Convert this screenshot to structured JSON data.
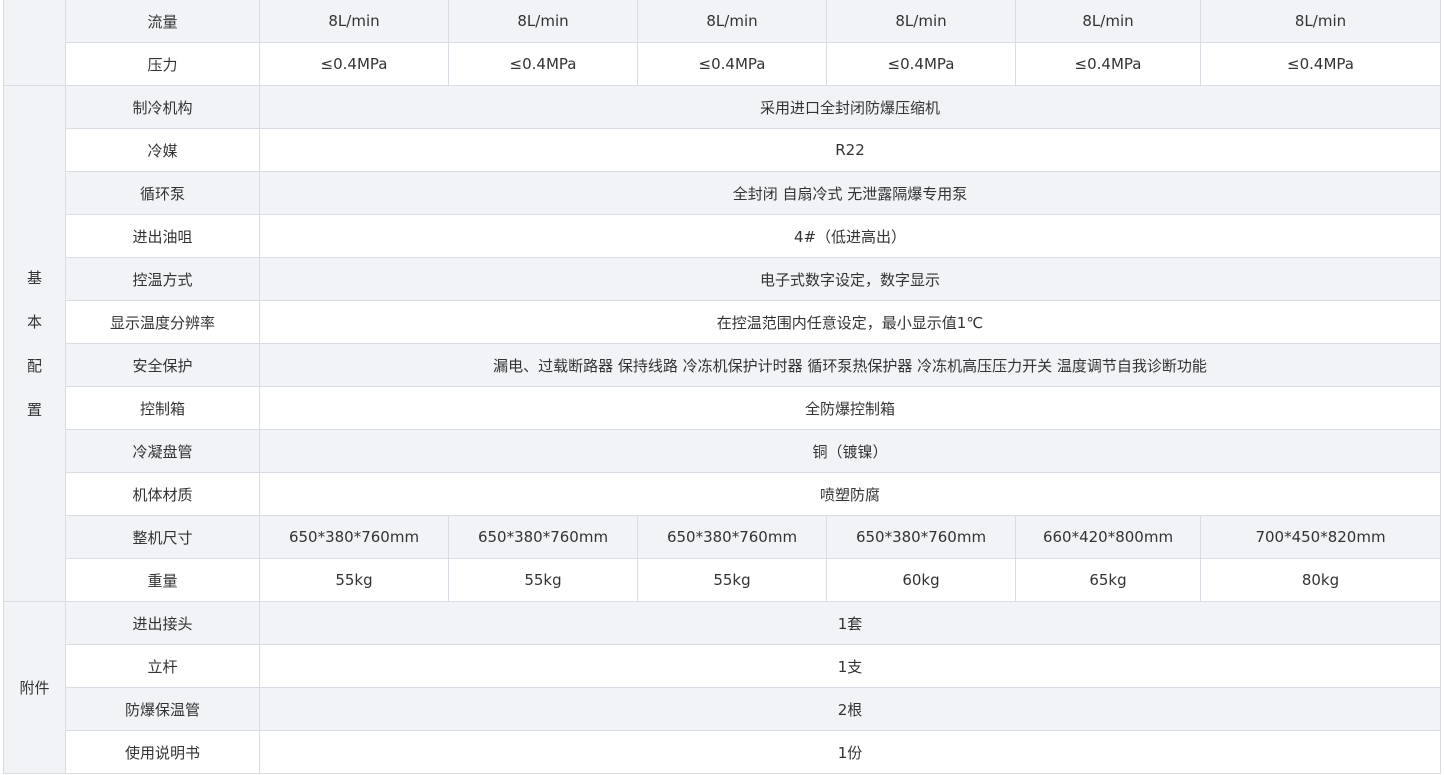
{
  "top_rows": [
    {
      "label": "流量",
      "values": [
        "8L/min",
        "8L/min",
        "8L/min",
        "8L/min",
        "8L/min",
        "8L/min"
      ]
    },
    {
      "label": "压力",
      "values": [
        "≤0.4MPa",
        "≤0.4MPa",
        "≤0.4MPa",
        "≤0.4MPa",
        "≤0.4MPa",
        "≤0.4MPa"
      ]
    }
  ],
  "basic_config": {
    "group_chars": [
      "基",
      "本",
      "配",
      "置"
    ],
    "span_rows": [
      {
        "label": "制冷机构",
        "value": "采用进口全封闭防爆压缩机"
      },
      {
        "label": "冷媒",
        "value": "R22"
      },
      {
        "label": "循环泵",
        "value": "全封闭 自扇冷式 无泄露隔爆专用泵"
      },
      {
        "label": "进出油咀",
        "value": "4#（低进高出）"
      },
      {
        "label": "控温方式",
        "value": "电子式数字设定，数字显示"
      },
      {
        "label": "显示温度分辨率",
        "value": "在控温范围内任意设定，最小显示值1℃"
      },
      {
        "label": "安全保护",
        "value": "漏电、过载断路器 保持线路 冷冻机保护计时器 循环泵热保护器  冷冻机高压压力开关 温度调节自我诊断功能"
      },
      {
        "label": "控制箱",
        "value": "全防爆控制箱"
      },
      {
        "label": "冷凝盘管",
        "value": "铜（镀镍）"
      },
      {
        "label": "机体材质",
        "value": "喷塑防腐"
      }
    ],
    "multi_rows": [
      {
        "label": "整机尺寸",
        "values": [
          "650*380*760mm",
          "650*380*760mm",
          "650*380*760mm",
          "650*380*760mm",
          "660*420*800mm",
          "700*450*820mm"
        ]
      },
      {
        "label": "重量",
        "values": [
          "55kg",
          "55kg",
          "55kg",
          "60kg",
          "65kg",
          "80kg"
        ]
      }
    ]
  },
  "accessories": {
    "group_label": "附件",
    "rows": [
      {
        "label": "进出接头",
        "value": "1套"
      },
      {
        "label": "立杆",
        "value": "1支"
      },
      {
        "label": "防爆保温管",
        "value": "2根"
      },
      {
        "label": "使用说明书",
        "value": "1份"
      }
    ]
  }
}
